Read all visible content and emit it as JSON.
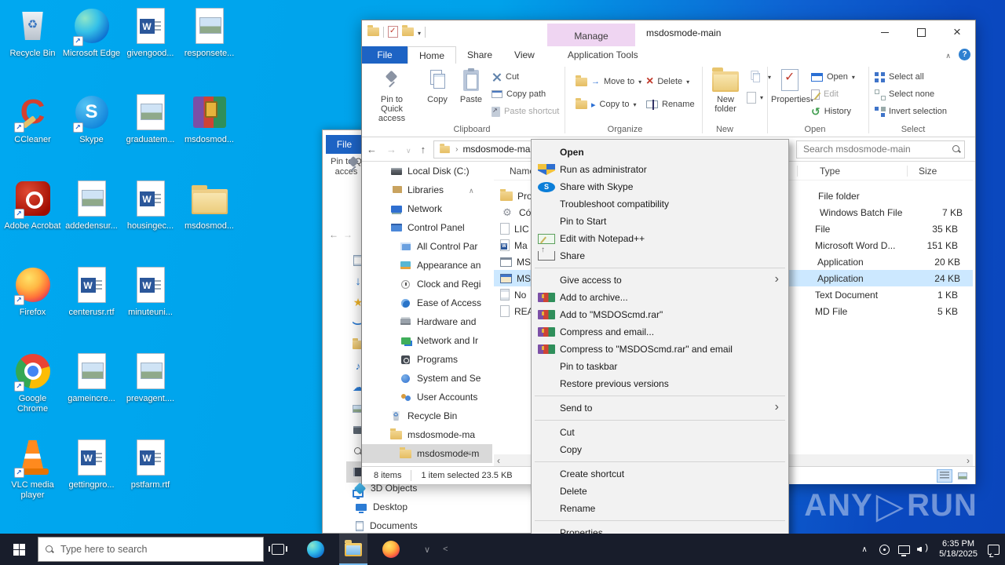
{
  "colors": {
    "desktop_left": "#00a2e8",
    "desktop_right": "#0a49c0",
    "taskbar_bg": "#181d2b",
    "selection_blue": "#cce8ff",
    "manage_tab_bg": "#efd5f2",
    "file_tab_blue": "#1d63c4",
    "active_underline": "#76b9ed"
  },
  "desktop": {
    "icons": [
      {
        "name": "desktop-icon-recycle-bin",
        "icon": "g-recycle",
        "label": "Recycle Bin"
      },
      {
        "name": "desktop-icon-microsoft-edge",
        "icon": "g-edge",
        "label": "Microsoft Edge",
        "shortcut": true
      },
      {
        "name": "desktop-icon-givengood",
        "icon": "g-worddoc",
        "label": "givengood..."
      },
      {
        "name": "desktop-icon-responsete",
        "icon": "g-imgdoc",
        "label": "responsete..."
      },
      {
        "name": "desktop-icon-ccleaner",
        "icon": "g-ccleaner",
        "label": "CCleaner",
        "shortcut": true
      },
      {
        "name": "desktop-icon-skype",
        "icon": "g-skype",
        "label": "Skype",
        "shortcut": true
      },
      {
        "name": "desktop-icon-graduatem",
        "icon": "g-imgdoc",
        "label": "graduatem..."
      },
      {
        "name": "desktop-icon-msdosmod-rar",
        "icon": "g-rar",
        "label": "msdosmod..."
      },
      {
        "name": "desktop-icon-adobe-acrobat",
        "icon": "g-acrobat",
        "label": "Adobe Acrobat",
        "shortcut": true
      },
      {
        "name": "desktop-icon-addedensur",
        "icon": "g-imgdoc",
        "label": "addedensur..."
      },
      {
        "name": "desktop-icon-housingec",
        "icon": "g-worddoc",
        "label": "housingec..."
      },
      {
        "name": "desktop-icon-msdosmod-folder",
        "icon": "g-folder",
        "label": "msdosmod..."
      },
      {
        "name": "desktop-icon-firefox",
        "icon": "g-firefox",
        "label": "Firefox",
        "shortcut": true
      },
      {
        "name": "desktop-icon-centerusr",
        "icon": "g-worddoc",
        "label": "centerusr.rtf"
      },
      {
        "name": "desktop-icon-minuteuni",
        "icon": "g-worddoc",
        "label": "minuteuni..."
      },
      {
        "empty": true
      },
      {
        "name": "desktop-icon-google-chrome",
        "icon": "g-chrome",
        "label": "Google Chrome",
        "shortcut": true
      },
      {
        "name": "desktop-icon-gameincre",
        "icon": "g-imgdoc",
        "label": "gameincre..."
      },
      {
        "name": "desktop-icon-prevagent",
        "icon": "g-imgdoc",
        "label": "prevagent...."
      },
      {
        "empty": true
      },
      {
        "name": "desktop-icon-vlc",
        "icon": "g-vlc",
        "label": "VLC media player",
        "shortcut": true
      },
      {
        "name": "desktop-icon-gettingpro",
        "icon": "g-worddoc",
        "label": "gettingpro..."
      },
      {
        "name": "desktop-icon-pstfarm",
        "icon": "g-worddoc",
        "label": "pstfarm.rtf"
      }
    ]
  },
  "back_window": {
    "file_tab": "File",
    "pin_line1": "Pin to Q",
    "pin_line2": "acces",
    "strip_icons": [
      {
        "name": "nav-icon-document",
        "icon": "s-doc"
      },
      {
        "name": "nav-icon-downloads",
        "icon": "s-down"
      },
      {
        "name": "nav-icon-favorites",
        "icon": "s-star"
      },
      {
        "name": "nav-icon-links",
        "icon": "s-curl"
      },
      {
        "name": "nav-icon-folder",
        "icon": "fold"
      },
      {
        "name": "nav-icon-music",
        "icon": "s-music"
      },
      {
        "name": "nav-icon-onedrive",
        "icon": "s-cloud"
      },
      {
        "name": "nav-icon-pictures",
        "icon": "s-pic"
      },
      {
        "name": "nav-icon-videos",
        "icon": "s-media"
      },
      {
        "name": "nav-icon-searches",
        "icon": "mag"
      },
      {
        "name": "nav-icon-film",
        "icon": "s-film",
        "selected": true
      },
      {
        "name": "nav-icon-this-pc",
        "icon": "s-monitor"
      }
    ],
    "bottom_items": [
      {
        "name": "tree-item-3d-objects",
        "icon": "b-3d",
        "label": "3D Objects"
      },
      {
        "name": "tree-item-desktop",
        "icon": "b-desktop",
        "label": "Desktop"
      },
      {
        "name": "tree-item-documents",
        "icon": "b-docs",
        "label": "Documents"
      }
    ]
  },
  "window": {
    "title": "msdosmode-main",
    "manage_label": "Manage",
    "tabs": [
      {
        "label": "File"
      },
      {
        "label": "Home"
      },
      {
        "label": "Share"
      },
      {
        "label": "View"
      },
      {
        "label": "Application Tools"
      }
    ],
    "help_label": "?",
    "ribbon": {
      "clipboard": {
        "pin": "Pin to Quick access",
        "copy": "Copy",
        "paste": "Paste",
        "cut": "Cut",
        "copy_path": "Copy path",
        "paste_shortcut": "Paste shortcut",
        "group": "Clipboard"
      },
      "organize": {
        "move_to": "Move to",
        "copy_to": "Copy to",
        "delete": "Delete",
        "rename": "Rename",
        "group": "Organize"
      },
      "new_group": {
        "new_folder": "New folder",
        "group": "New"
      },
      "open_group": {
        "properties": "Properties",
        "open": "Open",
        "edit": "Edit",
        "history": "History",
        "group": "Open"
      },
      "select_group": {
        "select_all": "Select all",
        "select_none": "Select none",
        "invert": "Invert selection",
        "group": "Select"
      }
    },
    "address": {
      "path": "msdosmode-main",
      "search_placeholder": "Search msdosmode-main"
    },
    "nav_tree": [
      {
        "name": "tree-item-local-disk-c",
        "icon": "t-disk",
        "label": "Local Disk (C:)"
      },
      {
        "name": "tree-item-libraries",
        "icon": "t-lib",
        "label": "Libraries"
      },
      {
        "name": "tree-item-network",
        "icon": "t-net",
        "label": "Network"
      },
      {
        "name": "tree-item-control-panel",
        "icon": "t-cpl",
        "label": "Control Panel"
      },
      {
        "name": "tree-item-all-control-panel",
        "icon": "t-allcpl",
        "label": "All Control Par",
        "indent": true
      },
      {
        "name": "tree-item-appearance",
        "icon": "t-appear",
        "label": "Appearance an",
        "indent": true
      },
      {
        "name": "tree-item-clock-region",
        "icon": "t-clock",
        "label": "Clock and Regi",
        "indent": true
      },
      {
        "name": "tree-item-ease-of-access",
        "icon": "t-ease",
        "label": "Ease of Access",
        "indent": true
      },
      {
        "name": "tree-item-hardware",
        "icon": "t-hw",
        "label": "Hardware and",
        "indent": true
      },
      {
        "name": "tree-item-network-internet",
        "icon": "t-netint",
        "label": "Network and Ir",
        "indent": true
      },
      {
        "name": "tree-item-programs",
        "icon": "t-prog",
        "label": "Programs",
        "indent": true
      },
      {
        "name": "tree-item-system-security",
        "icon": "t-sys",
        "label": "System and Se",
        "indent": true
      },
      {
        "name": "tree-item-user-accounts",
        "icon": "t-users",
        "label": "User Accounts",
        "indent": true
      },
      {
        "name": "tree-item-recycle-bin",
        "icon": "t-bin",
        "label": "Recycle Bin"
      },
      {
        "name": "tree-item-msdosmode-ma",
        "icon": "t-folder",
        "label": "msdosmode-ma"
      },
      {
        "name": "tree-item-msdosmode-m",
        "icon": "t-folder",
        "label": "msdosmode-m",
        "selected": true,
        "indent": true
      }
    ],
    "files": {
      "columns": [
        "Name",
        "Type",
        "Size"
      ],
      "rows": [
        {
          "name": "file-row-pro",
          "icon": "f-folder",
          "fname": "Pro",
          "ftype": "File folder",
          "fsize": ""
        },
        {
          "name": "file-row-co",
          "icon": "f-gear",
          "fname": "Có",
          "ftype": "Windows Batch File",
          "fsize": "7 KB"
        },
        {
          "name": "file-row-lic",
          "icon": "f-blank",
          "fname": "LIC",
          "ftype": "File",
          "fsize": "35 KB"
        },
        {
          "name": "file-row-ma",
          "icon": "f-word",
          "fname": "Ma",
          "ftype": "Microsoft Word D...",
          "fsize": "151 KB"
        },
        {
          "name": "file-row-ms-1",
          "icon": "f-app",
          "fname": "MS",
          "ftype": "Application",
          "fsize": "20 KB"
        },
        {
          "name": "file-row-ms-2",
          "icon": "f-appsel",
          "fname": "MS",
          "ftype": "Application",
          "fsize": "24 KB",
          "selected": true
        },
        {
          "name": "file-row-no",
          "icon": "f-text",
          "fname": "No",
          "ftype": "Text Document",
          "fsize": "1 KB"
        },
        {
          "name": "file-row-rea",
          "icon": "f-blank",
          "fname": "REA",
          "ftype": "MD File",
          "fsize": "5 KB"
        }
      ]
    },
    "status": {
      "items_count": "8 items",
      "selection_info": "1 item selected 23.5 KB"
    }
  },
  "context_menu": {
    "items": [
      {
        "name": "menu-item-open",
        "label": "Open",
        "bold": true
      },
      {
        "name": "menu-item-run-as-administrator",
        "icon": "m-uac",
        "label": "Run as administrator"
      },
      {
        "name": "menu-item-share-with-skype",
        "icon": "m-skype",
        "label": "Share with Skype"
      },
      {
        "name": "menu-item-troubleshoot-compatibility",
        "label": "Troubleshoot compatibility"
      },
      {
        "name": "menu-item-pin-to-start",
        "label": "Pin to Start"
      },
      {
        "name": "menu-item-edit-with-notepadpp",
        "icon": "m-npp",
        "label": "Edit with Notepad++"
      },
      {
        "name": "menu-item-share",
        "icon": "m-share",
        "label": "Share"
      },
      {
        "sep": true
      },
      {
        "name": "menu-item-give-access-to",
        "label": "Give access to",
        "submenu": true
      },
      {
        "name": "menu-item-add-to-archive",
        "icon": "m-rar",
        "label": "Add to archive..."
      },
      {
        "name": "menu-item-add-to-rar",
        "icon": "m-rar",
        "label": "Add to \"MSDOScmd.rar\""
      },
      {
        "name": "menu-item-compress-and-email",
        "icon": "m-rar",
        "label": "Compress and email..."
      },
      {
        "name": "menu-item-compress-to-rar-and-email",
        "icon": "m-rar",
        "label": "Compress to \"MSDOScmd.rar\" and email"
      },
      {
        "name": "menu-item-pin-to-taskbar",
        "label": "Pin to taskbar"
      },
      {
        "name": "menu-item-restore-previous-versions",
        "label": "Restore previous versions"
      },
      {
        "sep": true
      },
      {
        "name": "menu-item-send-to",
        "label": "Send to",
        "submenu": true
      },
      {
        "sep": true
      },
      {
        "name": "menu-item-cut",
        "label": "Cut"
      },
      {
        "name": "menu-item-copy",
        "label": "Copy"
      },
      {
        "sep": true
      },
      {
        "name": "menu-item-create-shortcut",
        "label": "Create shortcut"
      },
      {
        "name": "menu-item-delete",
        "label": "Delete"
      },
      {
        "name": "menu-item-rename",
        "label": "Rename"
      },
      {
        "sep": true
      },
      {
        "name": "menu-item-properties",
        "label": "Properties"
      }
    ]
  },
  "taskbar": {
    "search_placeholder": "Type here to search",
    "clock_time": "6:35 PM",
    "clock_date": "5/18/2025"
  },
  "watermark": {
    "left": "ANY",
    "right": "RUN"
  }
}
